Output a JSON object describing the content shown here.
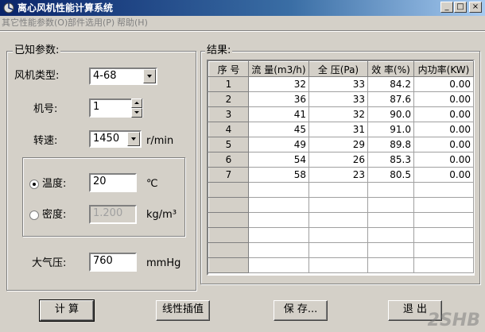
{
  "window": {
    "title": "离心风机性能计算系统"
  },
  "menu": [
    {
      "label": "其它性能参数(O)"
    },
    {
      "label": "部件选用(P)"
    },
    {
      "label": "帮助(H)"
    }
  ],
  "known": {
    "group_title": "已知参数:",
    "fan_type_label": "风机类型:",
    "fan_type_value": "4-68",
    "fan_no_label": "机号:",
    "fan_no_value": "1",
    "speed_label": "转速:",
    "speed_value": "1450",
    "speed_unit": "r/min",
    "temp_label": "温度:",
    "temp_value": "20",
    "temp_unit": "℃",
    "density_label": "密度:",
    "density_value": "1.200",
    "density_unit": "kg/m³",
    "pressure_label": "大气压:",
    "pressure_value": "760",
    "pressure_unit": "mmHg"
  },
  "results": {
    "group_title": "结果:",
    "columns": [
      "序 号",
      "流 量(m3/h)",
      "全 压(Pa)",
      "效 率(%)",
      "内功率(KW)"
    ],
    "rows": [
      [
        "1",
        "32",
        "33",
        "84.2",
        "0.00"
      ],
      [
        "2",
        "36",
        "33",
        "87.6",
        "0.00"
      ],
      [
        "3",
        "41",
        "32",
        "90.0",
        "0.00"
      ],
      [
        "4",
        "45",
        "31",
        "91.0",
        "0.00"
      ],
      [
        "5",
        "49",
        "29",
        "89.8",
        "0.00"
      ],
      [
        "6",
        "54",
        "26",
        "85.3",
        "0.00"
      ],
      [
        "7",
        "58",
        "23",
        "80.5",
        "0.00"
      ]
    ],
    "empty_rows": 6
  },
  "buttons": {
    "calc": "计 算",
    "interp": "线性插值",
    "save": "保 存...",
    "exit": "退 出"
  },
  "watermark": "2SHB"
}
